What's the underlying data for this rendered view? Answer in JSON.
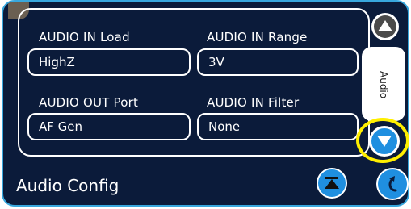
{
  "section_title": "Audio Config",
  "side_tab_label": "Audio",
  "fields": [
    {
      "label": "AUDIO IN Load",
      "value": "HighZ"
    },
    {
      "label": "AUDIO IN Range",
      "value": "3V"
    },
    {
      "label": "AUDIO OUT Port",
      "value": "AF Gen"
    },
    {
      "label": "AUDIO IN Filter",
      "value": "None"
    }
  ],
  "colors": {
    "panel_bg": "#0b1b3a",
    "panel_border": "#38a7dd",
    "accent_blue": "#1f8fe0",
    "highlight": "#ffef00"
  },
  "icons": {
    "scroll_up": "triangle-up-icon",
    "scroll_down": "triangle-down-icon",
    "collapse": "collapse-top-icon",
    "back": "return-arrow-icon"
  }
}
